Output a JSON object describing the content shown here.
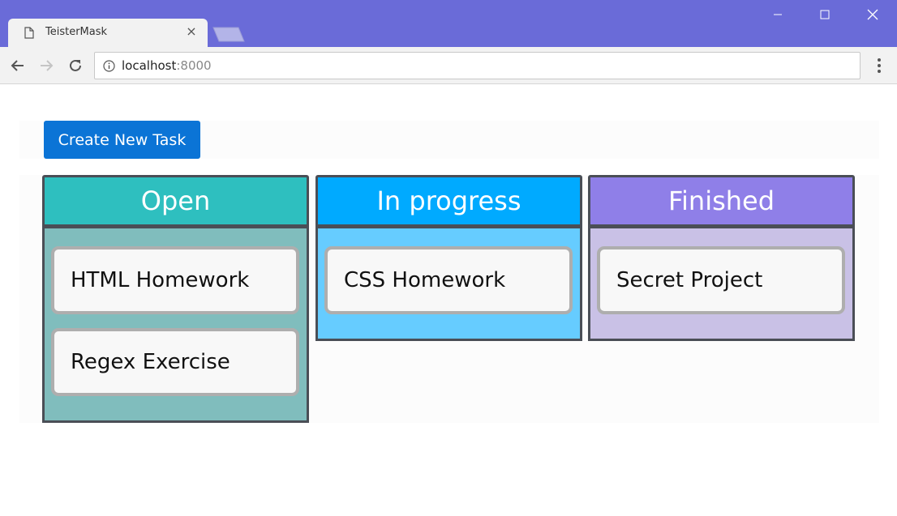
{
  "browser": {
    "tab_title": "TeisterMask",
    "tab_close": "×",
    "url_host": "localhost",
    "url_port": ":8000"
  },
  "page": {
    "create_button_label": "Create New Task"
  },
  "colors": {
    "titlebar": "#6a6bd8",
    "create_button": "#0b74d6",
    "open_header": "#2ebfbf",
    "open_body": "#80bdbd",
    "progress_header": "#00aaff",
    "progress_body": "#66ccff",
    "finished_header": "#8f7fe8",
    "finished_body": "#c9c1e6"
  },
  "columns": [
    {
      "title": "Open",
      "tasks": [
        "HTML Homework",
        "Regex Exercise"
      ]
    },
    {
      "title": "In progress",
      "tasks": [
        "CSS Homework"
      ]
    },
    {
      "title": "Finished",
      "tasks": [
        "Secret Project"
      ]
    }
  ]
}
